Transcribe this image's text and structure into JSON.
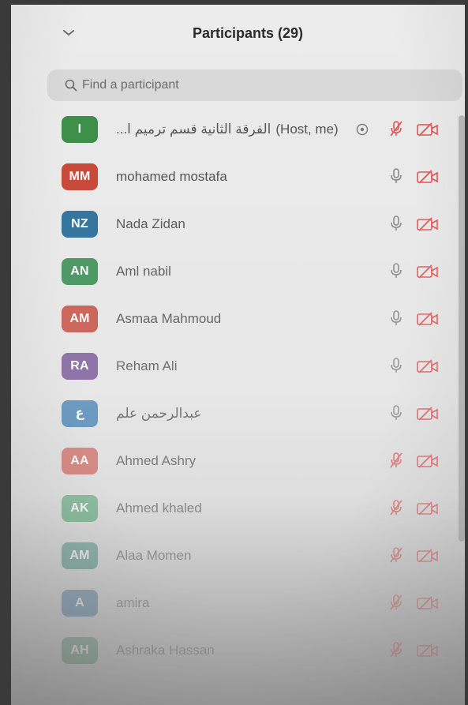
{
  "panel": {
    "title": "Participants (29)"
  },
  "search": {
    "placeholder": "Find a participant"
  },
  "colors": {
    "muted_red": "#e25555",
    "mic_gray": "#8a8a8a"
  },
  "participants": [
    {
      "initials": "I",
      "name": "...الفرقة الثانية قسم ترميم ا",
      "suffix": "(Host, me)",
      "avatar_color": "#3d8f4a",
      "mic": "muted",
      "video": "off",
      "fade": 1.0
    },
    {
      "initials": "MM",
      "name": "mohamed mostafa",
      "suffix": "",
      "avatar_color": "#c74a3b",
      "mic": "on",
      "video": "off",
      "fade": 1.0
    },
    {
      "initials": "NZ",
      "name": "Nada Zidan",
      "suffix": "",
      "avatar_color": "#2c6f9b",
      "mic": "on",
      "video": "off",
      "fade": 0.95
    },
    {
      "initials": "AN",
      "name": "Aml nabil",
      "suffix": "",
      "avatar_color": "#3f915a",
      "mic": "on",
      "video": "off",
      "fade": 0.9
    },
    {
      "initials": "AM",
      "name": "Asmaa Mahmoud",
      "suffix": "",
      "avatar_color": "#c9564b",
      "mic": "on",
      "video": "off",
      "fade": 0.88
    },
    {
      "initials": "RA",
      "name": "Reham Ali",
      "suffix": "",
      "avatar_color": "#7d5c9c",
      "mic": "on",
      "video": "off",
      "fade": 0.82
    },
    {
      "initials": "ع",
      "name": "عبدالرحمن علم",
      "suffix": "",
      "avatar_color": "#4c86b8",
      "mic": "on",
      "video": "off",
      "fade": 0.78
    },
    {
      "initials": "AA",
      "name": "Ahmed Ashry",
      "suffix": "",
      "avatar_color": "#d16a62",
      "mic": "muted",
      "video": "off",
      "fade": 0.72
    },
    {
      "initials": "AK",
      "name": "Ahmed khaled",
      "suffix": "",
      "avatar_color": "#5ba97a",
      "mic": "muted",
      "video": "off",
      "fade": 0.62
    },
    {
      "initials": "AM",
      "name": "Alaa Momen",
      "suffix": "",
      "avatar_color": "#4b917f",
      "mic": "muted",
      "video": "off",
      "fade": 0.5
    },
    {
      "initials": "A",
      "name": "amira",
      "suffix": "",
      "avatar_color": "#3f6f9a",
      "mic": "muted",
      "video": "off",
      "fade": 0.38
    },
    {
      "initials": "AH",
      "name": "Ashraka Hassan",
      "suffix": "",
      "avatar_color": "#4a8a63",
      "mic": "muted",
      "video": "off",
      "fade": 0.3
    }
  ]
}
